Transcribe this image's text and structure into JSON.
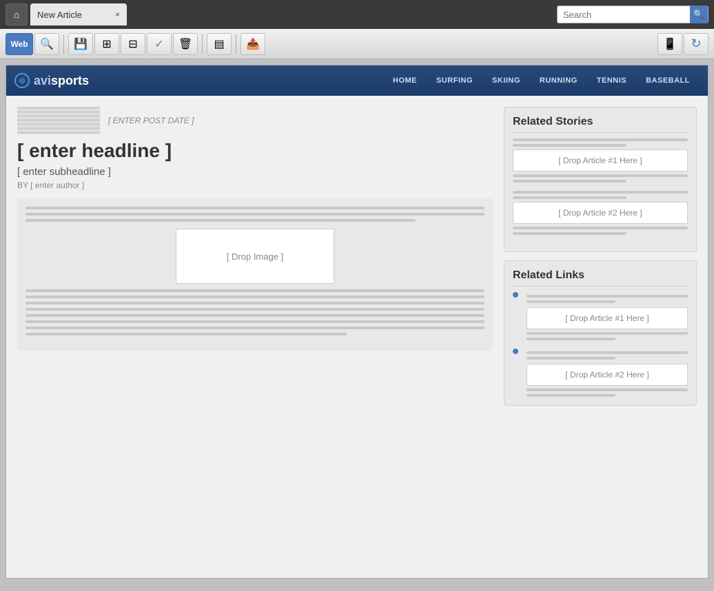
{
  "titleBar": {
    "homeIcon": "⌂",
    "tabLabel": "New Article",
    "tabCloseIcon": "×",
    "searchPlaceholder": "Search",
    "searchIcon": "🔍"
  },
  "toolbar": {
    "webLabel": "Web",
    "searchIcon": "🔍",
    "saveIcon": "💾",
    "gridIcon": "▦",
    "layoutIcon": "⊟",
    "checkIcon": "✓",
    "trashIcon": "🗑",
    "previewIcon": "▤",
    "uploadIcon": "📤",
    "mobileIcon": "📱",
    "refreshIcon": "↻"
  },
  "siteNav": {
    "logoText": "avisports",
    "logoAvi": "avi",
    "logoSports": "sports",
    "navItems": [
      "HOME",
      "SURFING",
      "SKIING",
      "RUNNING",
      "TENNIS",
      "BASEBALL"
    ]
  },
  "article": {
    "datePlaceholder": "[ ENTER POST DATE ]",
    "headlinePlaceholder": "[ enter headline ]",
    "subheadlinePlaceholder": "[ enter subheadline ]",
    "bylinePrefix": "BY",
    "authorPlaceholder": "[ enter author ]",
    "dropImageLabel": "[ Drop Image ]"
  },
  "relatedStories": {
    "title": "Related Stories",
    "dropZone1": "[ Drop Article #1 Here ]",
    "dropZone2": "[ Drop Article #2 Here ]"
  },
  "relatedLinks": {
    "title": "Related Links",
    "dropZone1": "[ Drop Article #1 Here ]",
    "dropZone2": "[ Drop Article #2 Here ]"
  }
}
